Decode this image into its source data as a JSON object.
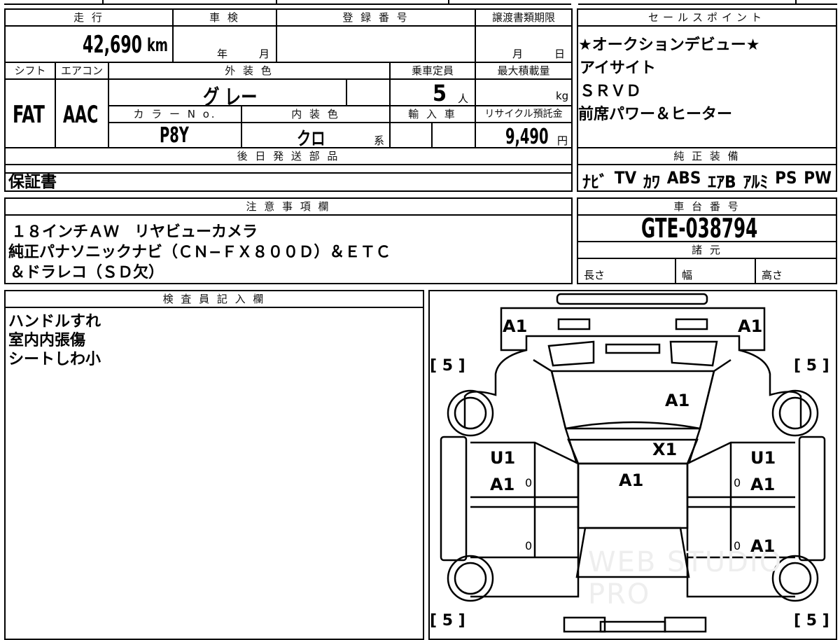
{
  "vehicle_info": {
    "mileage_label": "走 行",
    "mileage_value": "42,690",
    "mileage_unit": "km",
    "inspection_label": "車 検",
    "inspection_year_unit": "年",
    "inspection_month_unit": "月",
    "registration_label": "登 録 番 号",
    "registration_value": "",
    "transfer_deadline_label": "譲渡書類期限",
    "transfer_month_unit": "月",
    "transfer_day_unit": "日",
    "shift_label": "シフト",
    "shift_value": "FAT",
    "aircon_label": "エアコン",
    "aircon_value": "AAC",
    "exterior_color_label": "外 装 色",
    "exterior_color_value": "グ レー",
    "capacity_label": "乗車定員",
    "capacity_value": "5",
    "capacity_unit": "人",
    "max_load_label": "最大積載量",
    "max_load_unit": "kg",
    "color_no_label": "カ ラ ー N o.",
    "color_no_value": "P8Y",
    "interior_color_label": "内 装 色",
    "interior_color_value": "クロ",
    "interior_color_suffix": "系",
    "import_label": "輸 入 車",
    "recycle_label": "リサイクル預託金",
    "recycle_value": "9,490",
    "recycle_unit": "円"
  },
  "sales_points": {
    "label": "セールスポイント",
    "items": [
      "★オークションデビュー★",
      "アイサイト",
      "ＳＲＶＤ",
      "前席パワー＆ヒーター"
    ]
  },
  "later_parts": {
    "label": "後 日 発 送 部 品",
    "value": "保証書"
  },
  "genuine_equipment": {
    "label": "純 正 装 備",
    "items": [
      "ﾅﾋﾞ",
      "TV",
      "ｶﾜ",
      "ABS",
      "ｴｱB",
      "ｱﾙﾐ",
      "PS",
      "PW"
    ]
  },
  "notes": {
    "label": "注 意 事 項 欄",
    "lines": [
      "１８インチＡＷ　リヤビューカメラ",
      "純正パナソニックナビ（ＣＮ−ＦＸ８００Ｄ）＆ＥＴＣ",
      "＆ドラレコ（ＳＤ欠）"
    ]
  },
  "chassis": {
    "label": "車 台 番 号",
    "value": "GTE-038794"
  },
  "specs": {
    "label": "諸 元",
    "length_label": "長さ",
    "width_label": "幅",
    "height_label": "高さ"
  },
  "inspector": {
    "label": "検 査 員 記 入 欄",
    "lines": [
      "ハンドルすれ",
      "室内内張傷",
      "シートしわ小"
    ]
  },
  "diagram": {
    "front_left_mark": "A1",
    "front_right_mark": "A1",
    "hood_mark": "A1",
    "windshield_mark": "X1",
    "roof_mark": "A1",
    "left_front_door_marks": [
      "U1",
      "A1"
    ],
    "right_front_door_marks": [
      "U1",
      "A1"
    ],
    "right_rear_door_mark": "A1",
    "tire_grades": [
      "[ 5 ]",
      "[ 5 ]",
      "[ 5 ]",
      "[ 5 ]"
    ],
    "zero_marks": [
      "0",
      "0",
      "0",
      "0"
    ],
    "watermark": "WEB STUDIO PRO"
  }
}
